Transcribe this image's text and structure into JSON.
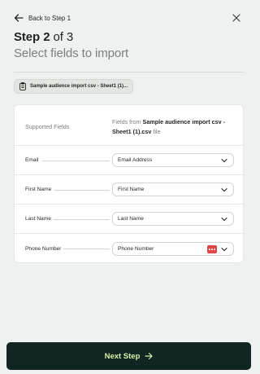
{
  "header": {
    "back_label": "Back to Step 1",
    "step_word": "Step",
    "step_current": "2",
    "step_of": "of 3",
    "subtitle": "Select fields to import"
  },
  "file_chip": {
    "label": "Sample audience import csv - Sheet1 (1)..."
  },
  "mapping_table": {
    "col_supported": "Supported Fields",
    "col_fields_prefix": "Fields from ",
    "col_fields_file": "Sample audience import csv - Sheet1 (1).csv",
    "col_fields_suffix": " file",
    "rows": [
      {
        "field": "Email",
        "selected": "Email Address"
      },
      {
        "field": "First Name",
        "selected": "First Name"
      },
      {
        "field": "Last Name",
        "selected": "Last Name"
      },
      {
        "field": "Phone Number",
        "selected": "Phone Number"
      }
    ]
  },
  "footer": {
    "next_label": "Next Step"
  },
  "colors": {
    "background": "#eef1ef",
    "button_bg": "#0f2622",
    "button_text": "#d9f0a8",
    "badge": "#e04848"
  },
  "icons": {
    "back": "arrow-left-icon",
    "close": "close-icon",
    "file": "clipboard-icon",
    "dropdown": "chevron-down-icon",
    "more": "more-dots-icon",
    "next": "arrow-right-icon"
  }
}
